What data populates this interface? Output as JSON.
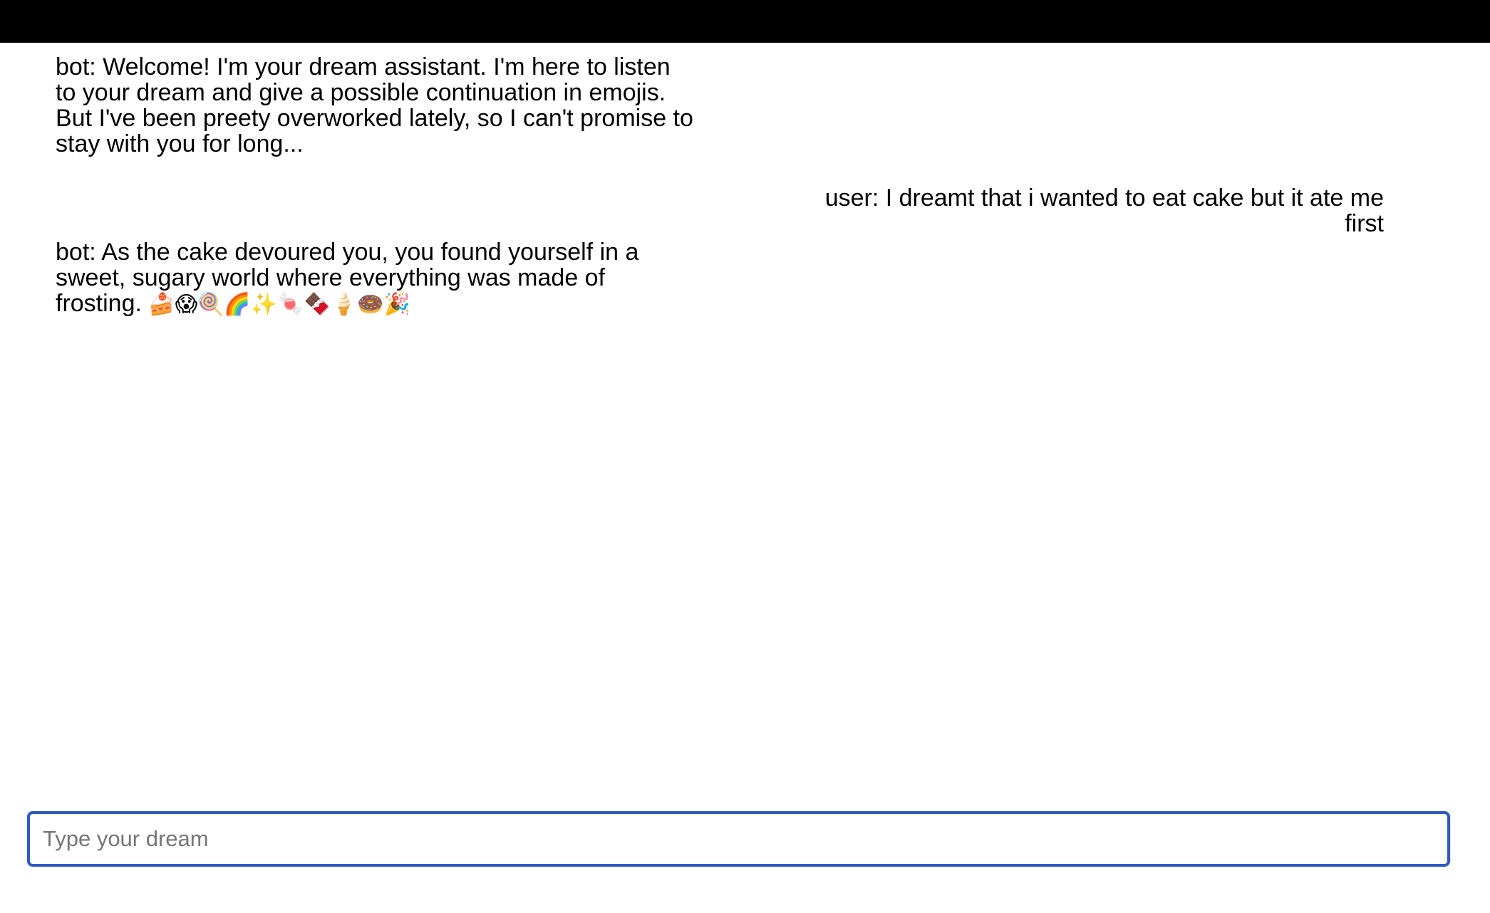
{
  "chat": {
    "messages": [
      {
        "role": "bot",
        "text": "bot: Welcome! I'm your dream assistant. I'm here to listen to your dream and give a possible continuation in emojis. But I've been preety overworked lately, so I can't promise to stay with you for long..."
      },
      {
        "role": "user",
        "text": "user: I dreamt that i wanted to eat cake but it ate me first"
      },
      {
        "role": "bot",
        "text": "bot: As the cake devoured you, you found yourself in a sweet, sugary world where everything was made of frosting.",
        "emojis": "🍰😱🍭🌈✨🍬🍫🍦🍩🎉"
      }
    ]
  },
  "input": {
    "placeholder": "Type your dream",
    "value": ""
  },
  "colors": {
    "top_bar": "#000000",
    "input_border": "#2f5bbf",
    "background": "#ffffff"
  }
}
